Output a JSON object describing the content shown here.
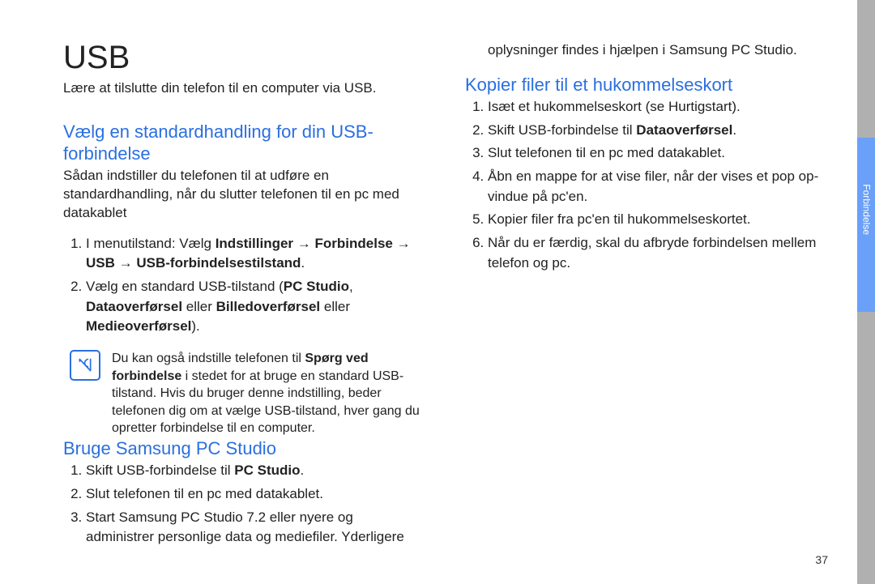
{
  "sideTab": {
    "label": "Forbindelse"
  },
  "pageNumber": "37",
  "left": {
    "title": "USB",
    "intro": "Lære at tilslutte din telefon til en computer via USB.",
    "h2": "Vælg en standardhandling for din USB-forbindelse",
    "lead": "Sådan indstiller du telefonen til at udføre en standardhandling, når du slutter telefonen til en pc med datakablet",
    "step1_a": "I menutilstand: Vælg ",
    "step1_b": "Indstillinger",
    "step1_c": " → ",
    "step1_d": "Forbindelse",
    "step1_e": " → ",
    "step1_f": "USB",
    "step1_g": " → ",
    "step1_h": "USB-forbindelsestilstand",
    "step1_i": ".",
    "step2_a": "Vælg en standard USB-tilstand (",
    "step2_b": "PC Studio",
    "step2_c": ", ",
    "step2_d": "Dataoverførsel",
    "step2_e": " eller ",
    "step2_f": "Billedoverførsel",
    "step2_g": " eller ",
    "step2_h": "Medieoverførsel",
    "step2_i": ").",
    "note_a": "Du kan også indstille telefonen til ",
    "note_b": "Spørg ved forbindelse",
    "note_c": " i stedet for at bruge en standard USB-tilstand. Hvis du bruger denne indstilling, beder telefonen dig om at vælge USB-tilstand, hver gang du opretter forbindelse til en computer."
  },
  "right": {
    "h2a": "Bruge Samsung PC Studio",
    "a1_a": "Skift USB-forbindelse til ",
    "a1_b": "PC Studio",
    "a1_c": ".",
    "a2": "Slut telefonen til en pc med datakablet.",
    "a3": "Start Samsung PC Studio 7.2 eller nyere og administrer personlige data og mediefiler. Yderligere oplysninger findes i hjælpen i Samsung PC Studio.",
    "h2b": "Kopier filer til et hukommelseskort",
    "b1": "Isæt et hukommelseskort (se Hurtigstart).",
    "b2_a": "Skift USB-forbindelse til ",
    "b2_b": "Dataoverførsel",
    "b2_c": ".",
    "b3": "Slut telefonen til en pc med datakablet.",
    "b4": "Åbn en mappe for at vise filer, når der vises et pop op-vindue på pc'en.",
    "b5": "Kopier filer fra pc'en til hukommelseskortet.",
    "b6": "Når du er færdig, skal du afbryde forbindelsen mellem telefon og pc."
  }
}
